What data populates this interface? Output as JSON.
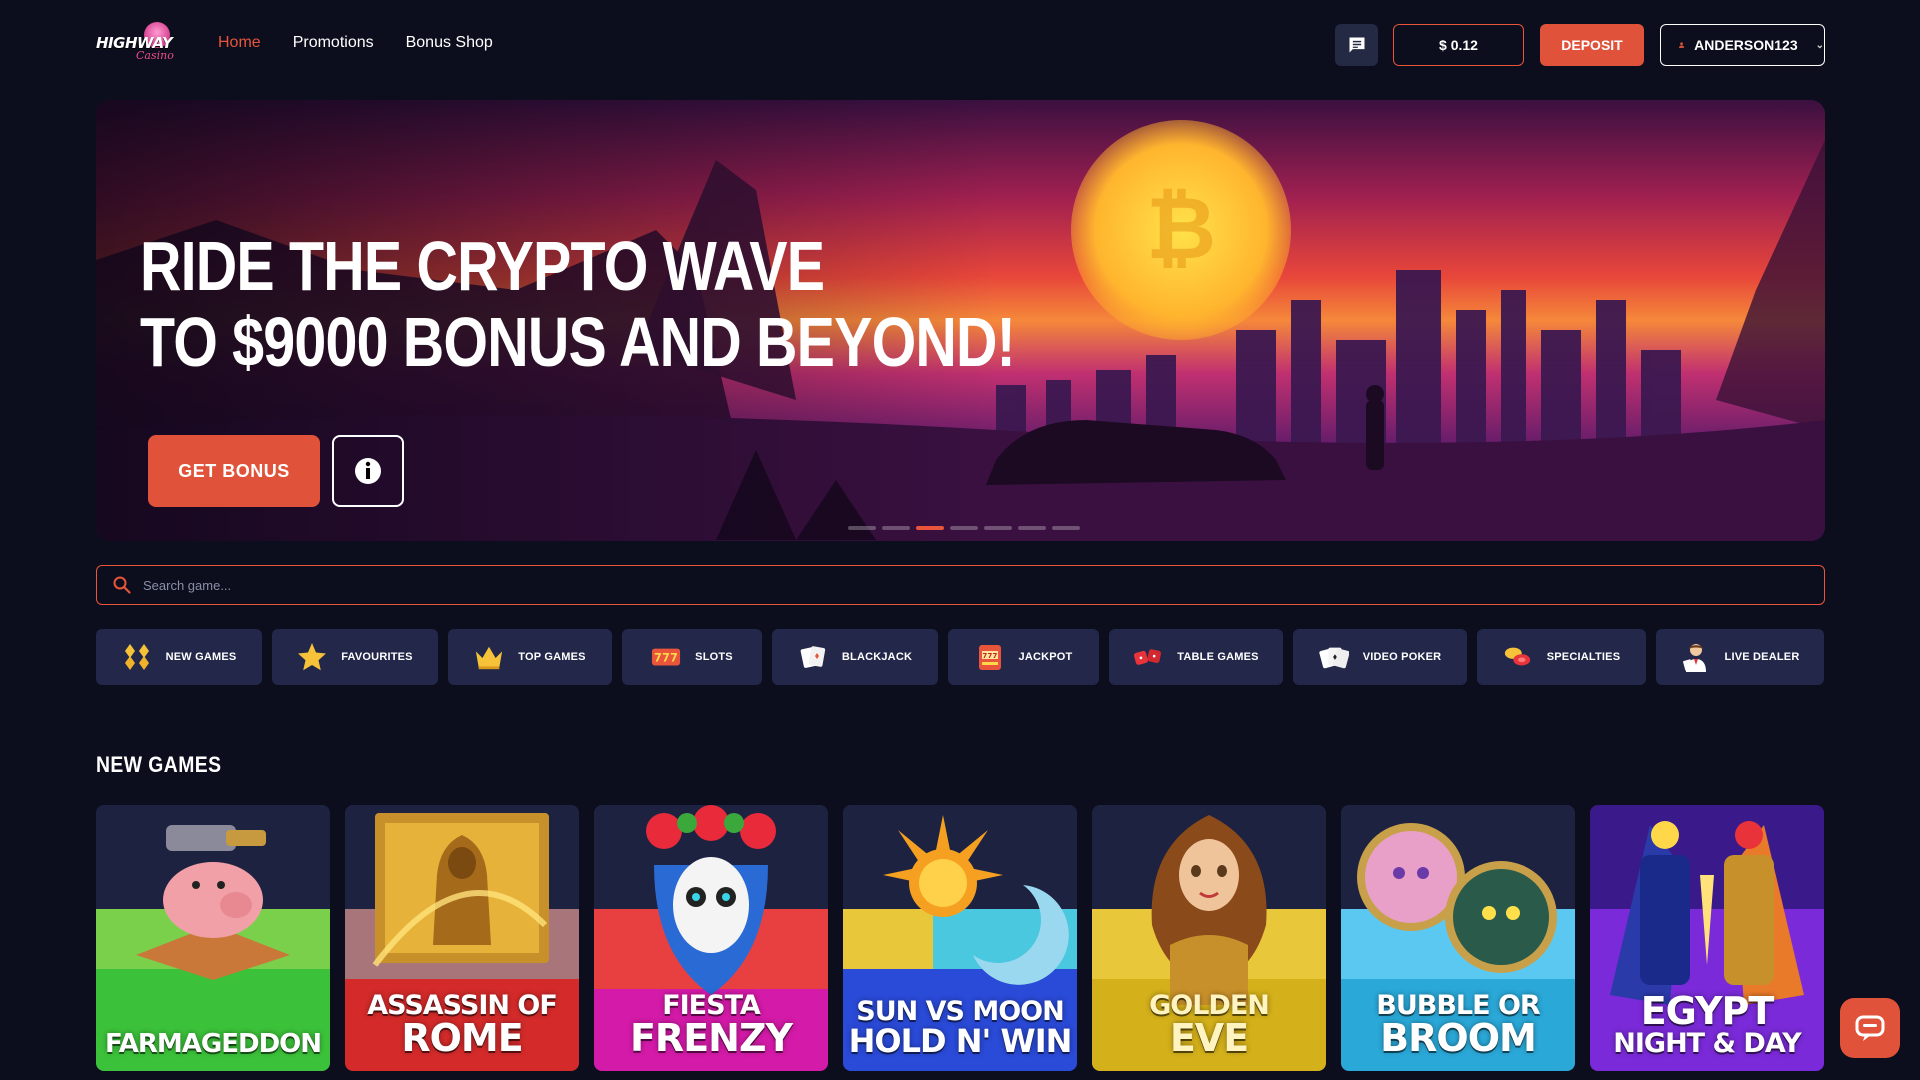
{
  "header": {
    "logo_text": "HIGHWAY",
    "logo_sub": "Casino",
    "nav": [
      {
        "label": "Home",
        "active": true
      },
      {
        "label": "Promotions",
        "active": false
      },
      {
        "label": "Bonus Shop",
        "active": false
      }
    ],
    "balance": "$ 0.12",
    "deposit_label": "DEPOSIT",
    "username": "ANDERSON123"
  },
  "hero": {
    "headline_line1": "RIDE THE CRYPTO WAVE",
    "headline_line2": "TO $9000 BONUS AND BEYOND!",
    "cta_label": "GET BONUS",
    "slides_total": 7,
    "active_slide": 3
  },
  "search": {
    "placeholder": "Search game..."
  },
  "categories": [
    {
      "label": "NEW GAMES",
      "icon": "gems-icon"
    },
    {
      "label": "FAVOURITES",
      "icon": "star-icon"
    },
    {
      "label": "TOP GAMES",
      "icon": "crown-icon"
    },
    {
      "label": "SLOTS",
      "icon": "slots-777-icon"
    },
    {
      "label": "BLACKJACK",
      "icon": "cards-icon"
    },
    {
      "label": "JACKPOT",
      "icon": "slot-machine-icon"
    },
    {
      "label": "TABLE GAMES",
      "icon": "dice-icon"
    },
    {
      "label": "VIDEO POKER",
      "icon": "poker-cards-icon"
    },
    {
      "label": "SPECIALTIES",
      "icon": "chips-icon"
    },
    {
      "label": "LIVE DEALER",
      "icon": "dealer-icon"
    }
  ],
  "new_games": {
    "title": "NEW GAMES",
    "items": [
      {
        "line1": "FARMAGEDDON",
        "line2": ""
      },
      {
        "line1": "ASSASSIN OF",
        "line2": "ROME"
      },
      {
        "line1": "FIESTA",
        "line2": "FRENZY"
      },
      {
        "line1": "SUN VS MOON",
        "line2": "HOLD N' WIN"
      },
      {
        "line1": "GOLDEN",
        "line2": "EVE"
      },
      {
        "line1": "BUBBLE OR",
        "line2": "BROOM"
      },
      {
        "line1": "EGYPT",
        "line2": "NIGHT & DAY"
      }
    ]
  },
  "colors": {
    "accent": "#e0533a",
    "background": "#0c0e1d",
    "category_bg": "#23284a"
  }
}
